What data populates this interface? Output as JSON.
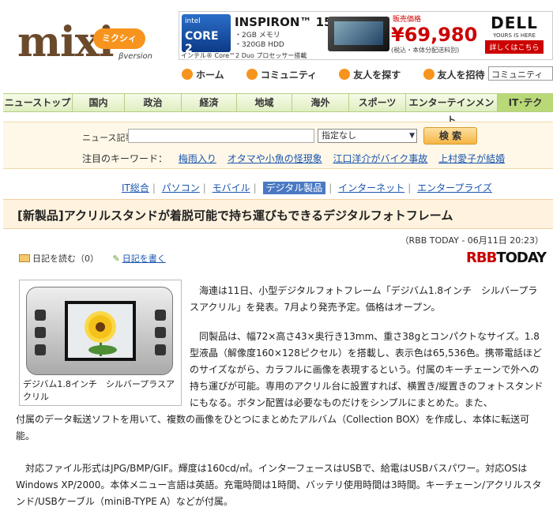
{
  "header": {
    "logo": "mixi",
    "logo_badge": "ミクシィ",
    "beta": "βversion",
    "ad": {
      "intel_line1": "intel",
      "intel_line2": "CORE 2",
      "intel_line3": "Duo inside",
      "title": "INSPIRON™ 15",
      "spec1": "・2GB メモリ",
      "spec2": "・320GB HDD",
      "foot": "インテル® Core™2 Duo プロセッサー搭載",
      "price_label": "販売価格",
      "price": "¥69,980",
      "price_note": "(税込・本体分配送料別)",
      "brand": "DELL",
      "brand_sub": "YOURS IS HERE",
      "cta": "詳しくはこちら"
    },
    "nav": [
      "ホーム",
      "コミュニティ",
      "友人を探す",
      "友人を招待"
    ],
    "nav_select": "コミュニティ"
  },
  "categories": [
    "ニューストップ",
    "国内",
    "政治",
    "経済",
    "地域",
    "海外",
    "スポーツ",
    "エンターテインメント",
    "IT･テク"
  ],
  "search": {
    "label": "ニュース記事",
    "placeholder": "",
    "select_value": "指定なし",
    "button": "検 索",
    "keyword_label": "注目のキーワード：",
    "keywords": [
      "梅雨入り",
      "オタマや小魚の怪現象",
      "江口洋介がバイク事故",
      "上村愛子が結婚"
    ]
  },
  "subcategories": [
    "IT総合",
    "パソコン",
    "モバイル",
    "デジタル製品",
    "インターネット",
    "エンタープライズ"
  ],
  "subcategory_current": "デジタル製品",
  "article": {
    "title": "[新製品]アクリルスタンドが着脱可能で持ち運びもできるデジタルフォトフレーム",
    "byline": "（RBB TODAY - 06月11日 20:23）",
    "diary_read": "日記を読む（0）",
    "diary_write": "日記を書く",
    "source_logo_a": "RBB",
    "source_logo_b": "TODAY",
    "photo_caption": "デジバム1.8インチ　シルバープラスアクリル",
    "para1": "　海連は11日、小型デジタルフォトフレーム「デジバム1.8インチ　シルバープラスアクリル」を発表。7月より発売予定。価格はオープン。",
    "para2": "　同製品は、幅72×高さ43×奥行き13mm、重さ38gとコンパクトなサイズ。1.8型液晶（解像度160×128ピクセル）を搭載し、表示色は65,536色。携帯電話ほどのサイズながら、カラフルに画像を表現するという。付属のキーチェーンで外への持ち運びが可能。専用のアクリル台に設置すれば、横置き/縦置きのフォトスタンドにもなる。ボタン配置は必要なものだけをシンプルにまとめた。また、付属のデータ転送ソフトを用いて、複数の画像をひとつにまとめたアルバム（Collection BOX）を作成し、本体に転送可能。",
    "para3": "　対応ファイル形式はJPG/BMP/GIF。輝度は160cd/㎡。インターフェースはUSBで、給電はUSBバスパワー。対応OSはWindows XP/2000。本体メニュー言語は英語。充電時間は1時間、バッテリ使用時間は3時間。キーチェーン/アクリルスタンド/USBケーブル（miniB-TYPE A）などが付属。"
  },
  "colors": {
    "brand_orange": "#f7941d",
    "category_green": "#dfeec0",
    "link_blue": "#1a55b0",
    "title_bg": "#fff3df"
  }
}
